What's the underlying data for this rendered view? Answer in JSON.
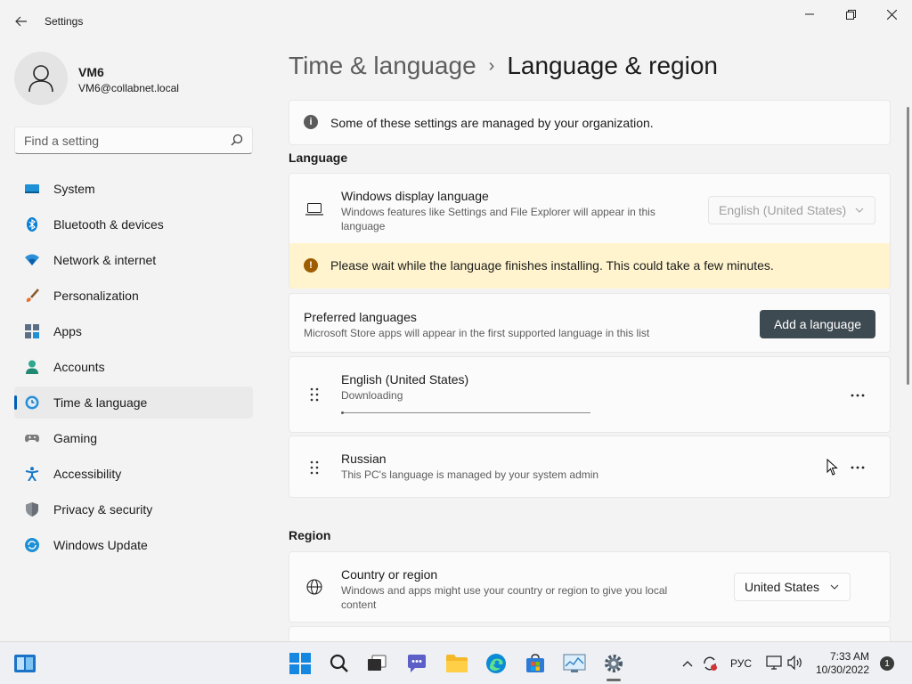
{
  "window": {
    "title": "Settings",
    "back_glyph": "←"
  },
  "user": {
    "name": "VM6",
    "email": "VM6@collabnet.local"
  },
  "search": {
    "placeholder": "Find a setting"
  },
  "sidebar": {
    "items": [
      {
        "label": "System",
        "icon": "system-icon"
      },
      {
        "label": "Bluetooth & devices",
        "icon": "bluetooth-icon"
      },
      {
        "label": "Network & internet",
        "icon": "network-icon"
      },
      {
        "label": "Personalization",
        "icon": "brush-icon"
      },
      {
        "label": "Apps",
        "icon": "apps-icon"
      },
      {
        "label": "Accounts",
        "icon": "accounts-icon"
      },
      {
        "label": "Time & language",
        "icon": "time-language-icon",
        "active": true
      },
      {
        "label": "Gaming",
        "icon": "gaming-icon"
      },
      {
        "label": "Accessibility",
        "icon": "accessibility-icon"
      },
      {
        "label": "Privacy & security",
        "icon": "shield-icon"
      },
      {
        "label": "Windows Update",
        "icon": "update-icon"
      }
    ]
  },
  "breadcrumb": {
    "parent": "Time & language",
    "separator": "›",
    "current": "Language & region"
  },
  "info_banner": {
    "text": "Some of these settings are managed by your organization."
  },
  "language_section": {
    "title": "Language",
    "display_language": {
      "title": "Windows display language",
      "subtitle_line1": "Windows features like Settings and File Explorer will appear in this",
      "subtitle_line2": "language",
      "value": "English (United States)"
    },
    "warning": "Please wait while the language finishes installing. This could take a few minutes.",
    "preferred": {
      "title": "Preferred languages",
      "subtitle": "Microsoft Store apps will appear in the first supported language in this list",
      "add_button": "Add a language"
    },
    "languages": [
      {
        "name": "English (United States)",
        "status": "Downloading",
        "progress": 0.01
      },
      {
        "name": "Russian",
        "status": "This PC's language is managed by your system admin"
      }
    ]
  },
  "region_section": {
    "title": "Region",
    "country": {
      "title": "Country or region",
      "subtitle_line1": "Windows and apps might use your country or region to give you local",
      "subtitle_line2": "content",
      "value": "United States"
    }
  },
  "taskbar": {
    "input_language": "РУС",
    "time": "7:33 AM",
    "date": "10/30/2022",
    "notification_count": "1"
  },
  "colors": {
    "accent": "#005fb8",
    "warning_bg": "#fff4ce",
    "add_button_bg": "#3e4a52"
  }
}
